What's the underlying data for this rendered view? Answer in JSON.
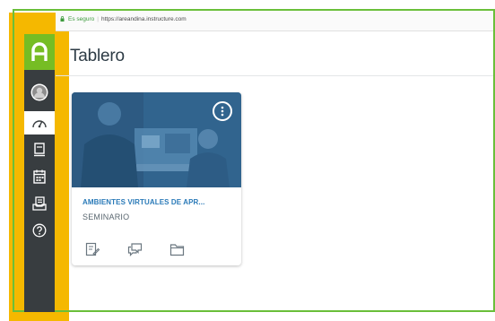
{
  "browser": {
    "secure_label": "Es seguro",
    "url": "https://areandina.instructure.com"
  },
  "nav": {
    "items": [
      {
        "icon": "account-avatar-icon"
      },
      {
        "icon": "dashboard-icon",
        "active": true
      },
      {
        "icon": "courses-icon"
      },
      {
        "icon": "calendar-icon"
      },
      {
        "icon": "inbox-icon"
      },
      {
        "icon": "help-icon"
      }
    ]
  },
  "page": {
    "title": "Tablero"
  },
  "course_card": {
    "name": "AMBIENTES VIRTUALES DE APR...",
    "term": "SEMINARIO",
    "actions": [
      "assignments-icon",
      "discussions-icon",
      "files-icon"
    ]
  },
  "colors": {
    "nav_bg": "#383d40",
    "brand_green": "#76bd24",
    "highlight": "#f5b800",
    "link_blue": "#2a7ab8"
  }
}
